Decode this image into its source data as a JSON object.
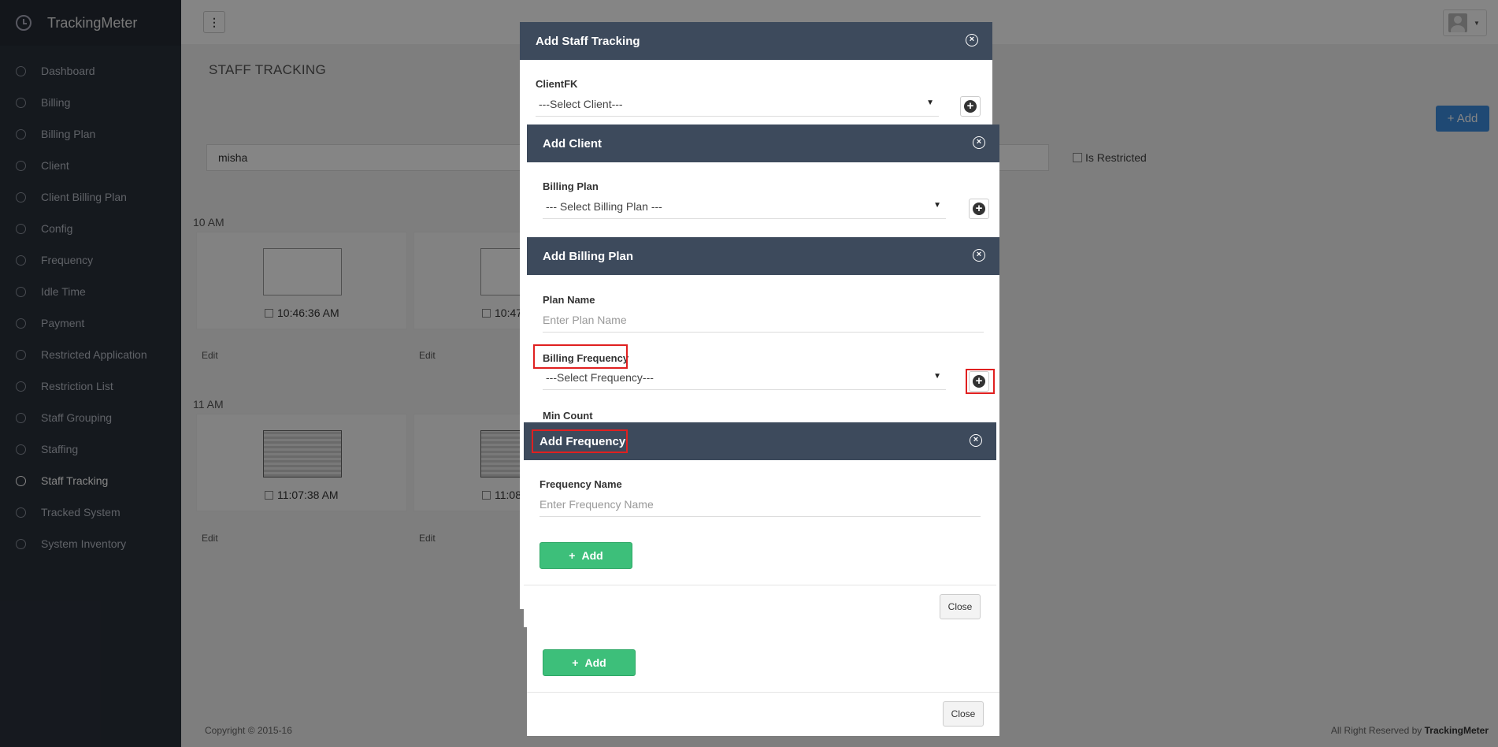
{
  "app": {
    "name": "TrackingMeter"
  },
  "sidebar": {
    "items": [
      {
        "label": "Dashboard"
      },
      {
        "label": "Billing"
      },
      {
        "label": "Billing Plan"
      },
      {
        "label": "Client"
      },
      {
        "label": "Client Billing Plan"
      },
      {
        "label": "Config"
      },
      {
        "label": "Frequency"
      },
      {
        "label": "Idle Time"
      },
      {
        "label": "Payment"
      },
      {
        "label": "Restricted Application"
      },
      {
        "label": "Restriction List"
      },
      {
        "label": "Staff Grouping"
      },
      {
        "label": "Staffing"
      },
      {
        "label": "Staff Tracking"
      },
      {
        "label": "Tracked System"
      },
      {
        "label": "System Inventory"
      }
    ],
    "active": "Staff Tracking"
  },
  "page": {
    "title": "STAFF TRACKING",
    "add_label": "+ Add",
    "search_value": "misha",
    "restricted_label": "Is Restricted",
    "groups": [
      {
        "hour": "10 AM",
        "cards": [
          {
            "time": "10:46:36 AM",
            "edit": "Edit"
          },
          {
            "time": "10:47",
            "edit": "Edit"
          }
        ]
      },
      {
        "hour": "11 AM",
        "cards": [
          {
            "time": "11:07:38 AM",
            "edit": "Edit"
          },
          {
            "time": "11:08",
            "edit": "Edit"
          }
        ]
      }
    ],
    "footer_left": "Copyright © 2015-16",
    "footer_right_prefix": "All Right Reserved by",
    "footer_right_brand": "TrackingMeter"
  },
  "modal_staff": {
    "title": "Add Staff Tracking",
    "client_label": "ClientFK",
    "client_select": "---Select Client---"
  },
  "modal_client": {
    "title": "Add Client",
    "billing_plan_label": "Billing Plan",
    "billing_plan_select": "--- Select Billing Plan ---",
    "add_label": "Add",
    "close_label": "Close"
  },
  "modal_billing_plan": {
    "title": "Add Billing Plan",
    "plan_name_label": "Plan Name",
    "plan_name_placeholder": "Enter Plan Name",
    "frequency_label": "Billing Frequency",
    "frequency_select": "---Select Frequency---",
    "min_count_label": "Min Count"
  },
  "modal_frequency": {
    "title": "Add Frequency",
    "name_label": "Frequency Name",
    "name_placeholder": "Enter Frequency Name",
    "add_label": "Add",
    "close_label": "Close"
  },
  "colors": {
    "header": "#3d4a5c",
    "sidebar": "#2a303b",
    "success": "#3dbf7a",
    "primary": "#3c8dde",
    "highlight": "#e02020"
  }
}
